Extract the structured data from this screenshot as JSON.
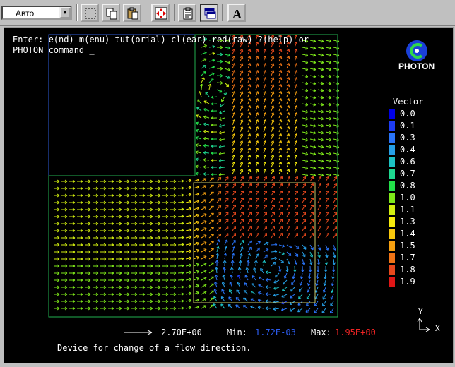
{
  "toolbar": {
    "combo_value": "Авто",
    "buttons": [
      "select-icon",
      "copy-icon",
      "paste-icon",
      "move-icon",
      "properties-icon",
      "window-icon",
      "font-icon"
    ]
  },
  "console": {
    "line1": "Enter: e(nd) m(enu) tut(orial) cl(ear) red(raw) ?(help) or",
    "line2": "PHOTON command _"
  },
  "logo": {
    "text": "PHOTON"
  },
  "legend": {
    "title": "Vector",
    "items": [
      {
        "label": "0.0",
        "color": "#0000e6"
      },
      {
        "label": "0.1",
        "color": "#1d3cf4"
      },
      {
        "label": "0.3",
        "color": "#2a74f8"
      },
      {
        "label": "0.4",
        "color": "#26a0e8"
      },
      {
        "label": "0.6",
        "color": "#1cc2c4"
      },
      {
        "label": "0.7",
        "color": "#1ed890"
      },
      {
        "label": "0.8",
        "color": "#22e04a"
      },
      {
        "label": "1.0",
        "color": "#7ee81a"
      },
      {
        "label": "1.1",
        "color": "#d2ee10"
      },
      {
        "label": "1.3",
        "color": "#f6ea0c"
      },
      {
        "label": "1.4",
        "color": "#f8c80c"
      },
      {
        "label": "1.5",
        "color": "#f6a010"
      },
      {
        "label": "1.7",
        "color": "#f07416"
      },
      {
        "label": "1.8",
        "color": "#e8481c"
      },
      {
        "label": "1.9",
        "color": "#e01616"
      }
    ]
  },
  "status": {
    "scale_value": "2.70E+00",
    "min_label": "Min:",
    "min_value": "1.72E-03",
    "max_label": "Max:",
    "max_value": "1.95E+00",
    "description": "Device for change of a flow direction."
  },
  "axes": {
    "y": "Y",
    "x": "X"
  }
}
